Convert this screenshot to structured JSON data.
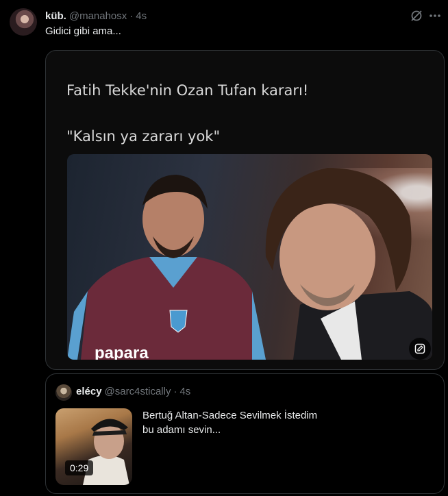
{
  "tweet": {
    "display_name": "küb.",
    "handle": "@manahosx",
    "separator": "·",
    "time": "4s",
    "text": "Gidici gibi ama..."
  },
  "icons": {
    "grok": "grok-icon",
    "more": "more-icon",
    "edit_media": "edit-media-icon"
  },
  "media": {
    "title": "Fatih Tekke'nin Ozan Tufan kararı!",
    "quote": "\"Kalsın ya zararı yok\""
  },
  "quoted_tweet": {
    "display_name": "elécy",
    "handle": "@sarc4stically",
    "separator": "·",
    "time": "4s",
    "line1": "Bertuğ Altan-Sadece Sevilmek İstedim",
    "line2": "bu adamı sevin...",
    "video_duration": "0:29"
  },
  "colors": {
    "background": "#000000",
    "text": "#e7e9ea",
    "muted": "#71767b",
    "border": "#2f3336"
  }
}
